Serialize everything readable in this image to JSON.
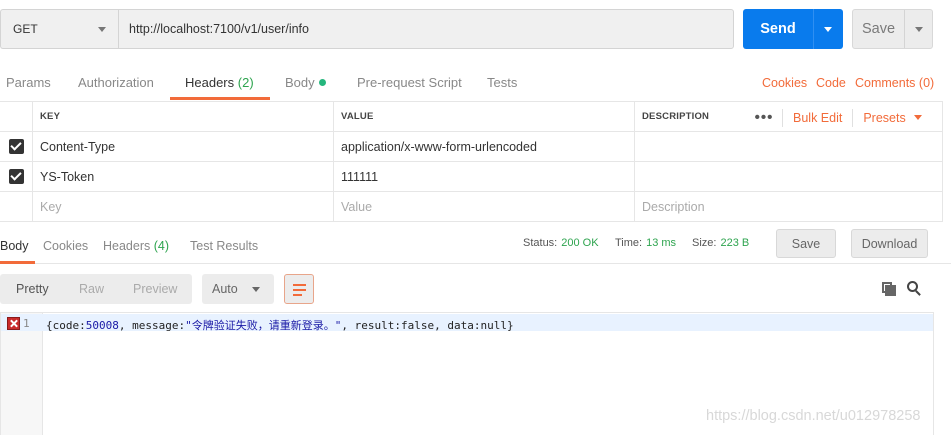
{
  "request": {
    "method": "GET",
    "url": "http://localhost:7100/v1/user/info",
    "send_label": "Send",
    "save_label": "Save"
  },
  "request_tabs": {
    "params": "Params",
    "authorization": "Authorization",
    "headers": "Headers",
    "headers_count": "(2)",
    "body": "Body",
    "prerequest": "Pre-request Script",
    "tests": "Tests",
    "cookies": "Cookies",
    "code": "Code",
    "comments": "Comments (0)"
  },
  "headers_table": {
    "col_key": "KEY",
    "col_value": "VALUE",
    "col_description": "DESCRIPTION",
    "more": "•••",
    "bulk_edit": "Bulk Edit",
    "presets": "Presets",
    "rows": [
      {
        "key": "Content-Type",
        "value": "application/x-www-form-urlencoded",
        "description": "",
        "checked": true
      },
      {
        "key": "YS-Token",
        "value": "111111",
        "description": "",
        "checked": true
      }
    ],
    "placeholder": {
      "key": "Key",
      "value": "Value",
      "description": "Description"
    }
  },
  "response": {
    "tabs": {
      "body": "Body",
      "cookies": "Cookies",
      "headers": "Headers",
      "headers_count": "(4)",
      "test_results": "Test Results"
    },
    "status_label": "Status:",
    "status_value": "200 OK",
    "time_label": "Time:",
    "time_value": "13 ms",
    "size_label": "Size:",
    "size_value": "223 B",
    "save_label": "Save",
    "download_label": "Download"
  },
  "view": {
    "pretty": "Pretty",
    "raw": "Raw",
    "preview": "Preview",
    "format": "Auto"
  },
  "code": {
    "line_number": "1",
    "open": "{code:",
    "code_val": "50008",
    "msg_key": ", message:",
    "msg_val": "\"令牌验证失败，请重新登录。\"",
    "result_key": ", result:",
    "result_val": "false",
    "data_key": ", data:",
    "data_val": "null",
    "close": "}"
  },
  "watermark": "https://blog.csdn.net/u012978258",
  "colors": {
    "accent": "#f26b3a",
    "send": "#097bed",
    "success": "#2ea44f"
  }
}
